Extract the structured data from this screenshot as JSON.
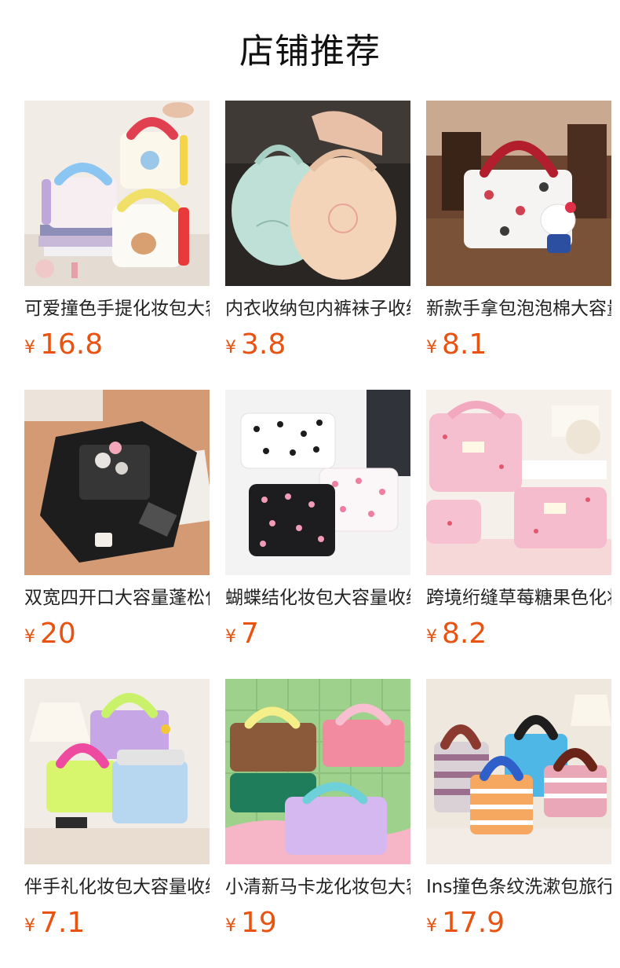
{
  "section": {
    "title": "店铺推荐"
  },
  "products": [
    {
      "name": "可爱撞色手提化妆包大容量",
      "currency": "¥",
      "price": "16.8",
      "image_icon": "cosmetic-bag-pastel-photo"
    },
    {
      "name": "内衣收纳包内裤袜子收纳袋",
      "currency": "¥",
      "price": "3.8",
      "image_icon": "underwear-pouch-photo"
    },
    {
      "name": "新款手拿包泡泡棉大容量",
      "currency": "¥",
      "price": "8.1",
      "image_icon": "kitty-handbag-photo"
    },
    {
      "name": "双宽四开口大容量蓬松化妆包",
      "currency": "¥",
      "price": "20",
      "image_icon": "black-organizer-photo"
    },
    {
      "name": "蝴蝶结化妆包大容量收纳",
      "currency": "¥",
      "price": "7",
      "image_icon": "bow-pouch-photo"
    },
    {
      "name": "跨境绗缝草莓糖果色化妆包",
      "currency": "¥",
      "price": "8.2",
      "image_icon": "strawberry-pouch-photo"
    },
    {
      "name": "伴手礼化妆包大容量收纳",
      "currency": "¥",
      "price": "7.1",
      "image_icon": "colorful-vanity-case-photo"
    },
    {
      "name": "小清新马卡龙化妆包大容量",
      "currency": "¥",
      "price": "19",
      "image_icon": "macaron-vanity-case-photo"
    },
    {
      "name": "Ins撞色条纹洗漱包旅行",
      "currency": "¥",
      "price": "17.9",
      "image_icon": "striped-toiletry-bag-photo"
    }
  ]
}
